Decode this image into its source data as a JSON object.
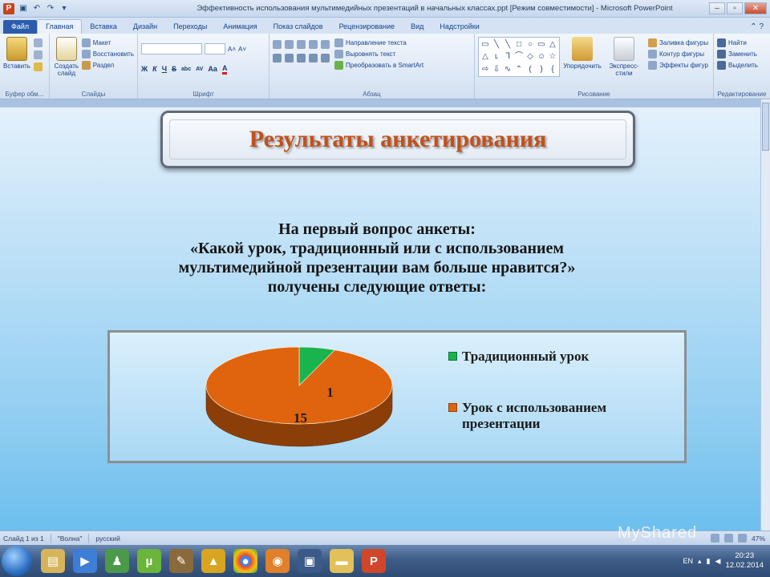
{
  "window": {
    "title": "Эффективность использования мультимедийных презентаций в начальных классах.ppt [Режим совместимости] - Microsoft PowerPoint",
    "minimize": "–",
    "maximize": "▫",
    "close": "✕"
  },
  "qat": {
    "save": "▣",
    "undo": "↶",
    "redo": "↷",
    "more": "▾"
  },
  "tabs": [
    "Файл",
    "Главная",
    "Вставка",
    "Дизайн",
    "Переходы",
    "Анимация",
    "Показ слайдов",
    "Рецензирование",
    "Вид",
    "Надстройки"
  ],
  "ribbon": {
    "clipboard": {
      "paste": "Вставить",
      "label": "Буфер обм..."
    },
    "slides": {
      "new_slide": "Создать слайд",
      "layout": "Макет",
      "reset": "Восстановить",
      "section": "Раздел",
      "label": "Слайды"
    },
    "font": {
      "grow": "A˄",
      "shrink": "A˅",
      "bold": "Ж",
      "italic": "К",
      "underline": "Ч",
      "strike": "S",
      "shadow": "abc",
      "spacing": "AV",
      "case": "Аа",
      "color": "A",
      "label": "Шрифт"
    },
    "paragraph": {
      "text_dir": "Направление текста",
      "align_text": "Выровнять текст",
      "smartart": "Преобразовать в SmartArt",
      "label": "Абзац"
    },
    "drawing": {
      "arrange": "Упорядочить",
      "quick_styles": "Экспресс-стили",
      "fill": "Заливка фигуры",
      "outline": "Контур фигуры",
      "effects": "Эффекты фигур",
      "label": "Рисование"
    },
    "editing": {
      "find": "Найти",
      "replace": "Заменить",
      "select": "Выделить",
      "label": "Редактирование"
    }
  },
  "slide": {
    "title": "Результаты анкетирования",
    "question_lines": [
      "На первый вопрос анкеты:",
      "«Какой урок, традиционный или с использованием",
      "мультимедийной презентации вам больше нравится?»",
      "получены следующие ответы:"
    ]
  },
  "chart_data": {
    "type": "pie",
    "style": "3d",
    "categories": [
      "Традиционный урок",
      "Урок с использованием презентации"
    ],
    "values": [
      1,
      15
    ],
    "data_labels": [
      "1",
      "15"
    ],
    "colors": [
      "#19b44e",
      "#e0640d"
    ],
    "legend_position": "right"
  },
  "statusbar": {
    "slide": "Слайд 1 из 1",
    "theme": "\"Волна\"",
    "language": "русский",
    "zoom": "47%"
  },
  "taskbar": {
    "lang": "EN",
    "time": "20:23",
    "date": "12.02.2014"
  }
}
